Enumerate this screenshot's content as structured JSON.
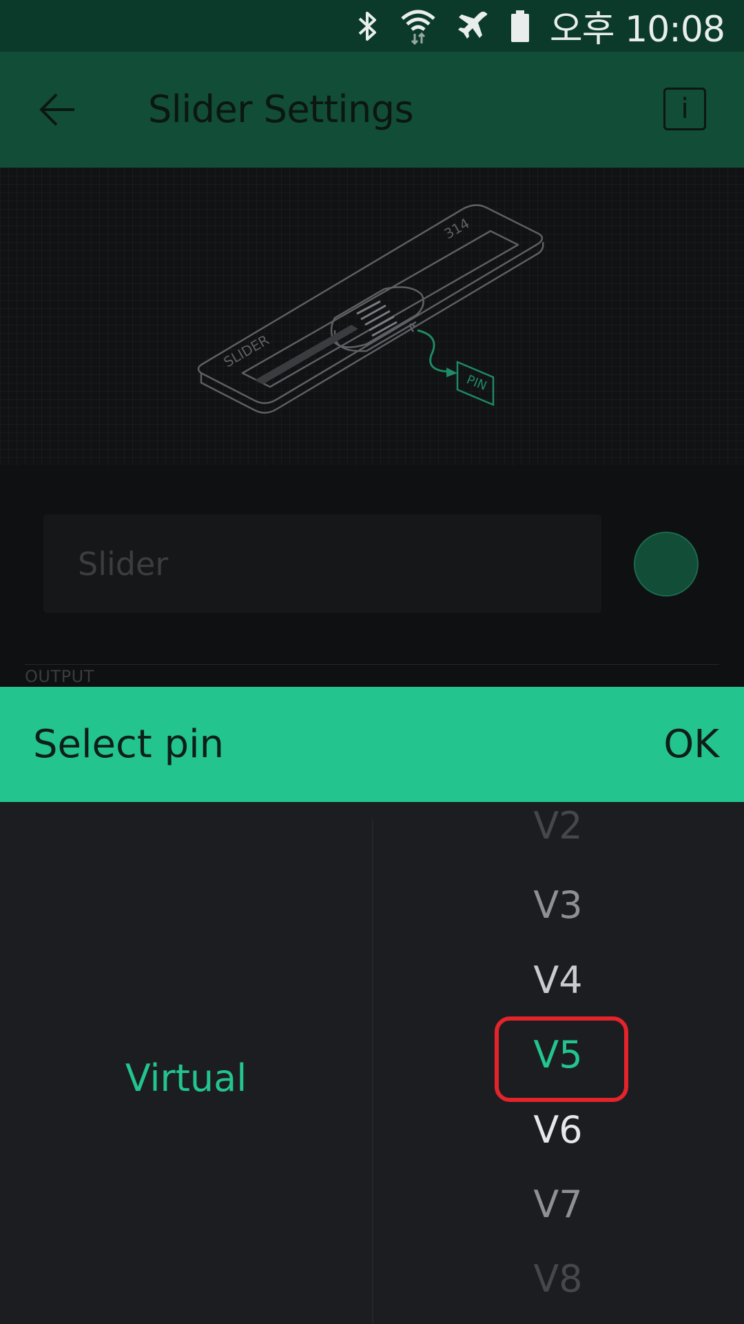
{
  "status_bar": {
    "time": "오후 10:08",
    "icons": [
      "bluetooth-icon",
      "wifi-icon",
      "airplane-mode-icon",
      "battery-icon"
    ]
  },
  "app_bar": {
    "title": "Slider Settings",
    "back_icon": "back-arrow-icon",
    "info_label": "i"
  },
  "illustration": {
    "device_label": "SLIDER",
    "value_label": "314",
    "pin_tag": "PIN"
  },
  "widget_name": {
    "placeholder": "Slider",
    "value": ""
  },
  "section": {
    "label": "OUTPUT"
  },
  "pin_dialog": {
    "title": "Select pin",
    "ok_label": "OK",
    "pin_type": "Virtual",
    "pins": [
      {
        "label": "V2",
        "color": "#45474b"
      },
      {
        "label": "V3",
        "color": "#8e9094"
      },
      {
        "label": "V4",
        "color": "#c9cbce"
      },
      {
        "label": "V5",
        "color": "#23c48e",
        "selected": true
      },
      {
        "label": "V6",
        "color": "#e6e7e9"
      },
      {
        "label": "V7",
        "color": "#8e9094"
      },
      {
        "label": "V8",
        "color": "#45474b"
      }
    ]
  },
  "colors": {
    "accent": "#23c48e",
    "app_bar": "#114d37",
    "status_bar": "#0b3a2b",
    "highlight": "#e3242b"
  }
}
